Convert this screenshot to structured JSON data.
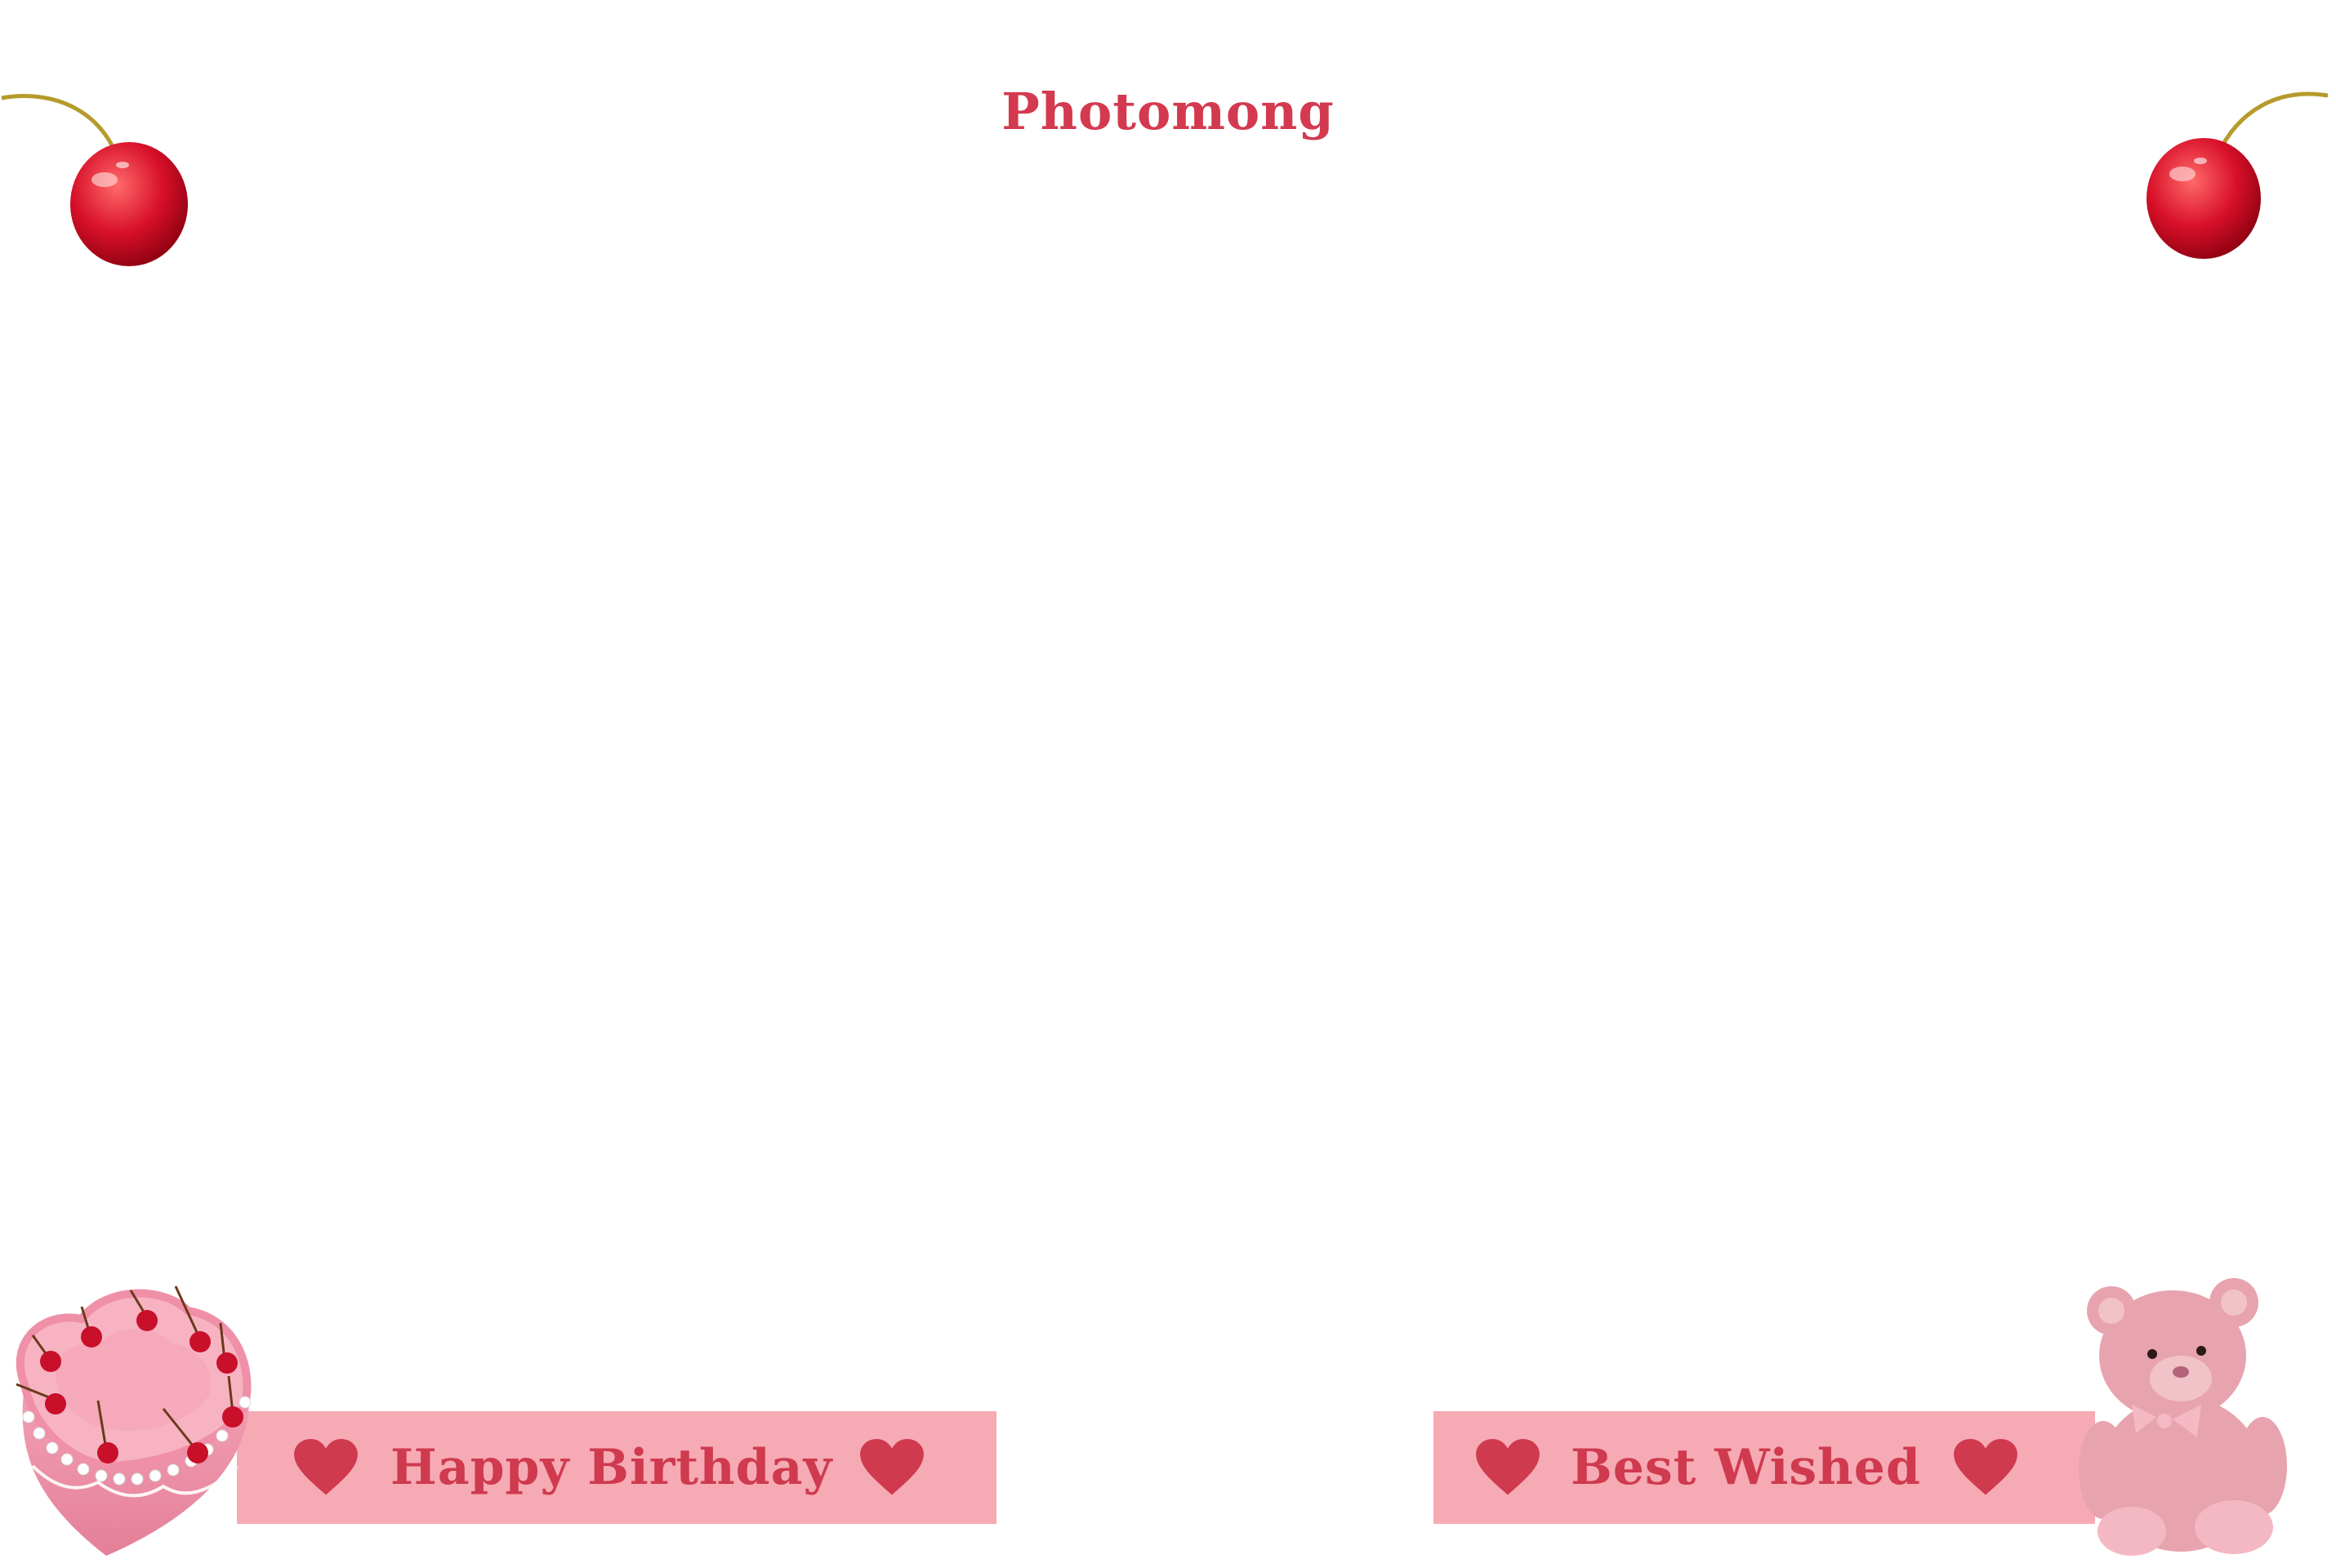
{
  "header": {
    "title": "Photomong"
  },
  "banners": {
    "left": {
      "text": "Happy Birthday"
    },
    "right": {
      "text": "Best Wished"
    }
  },
  "decorations": {
    "cherry_left": "cherry-icon",
    "cherry_right": "cherry-icon",
    "cake": "heart-cake-icon",
    "bear": "teddy-bear-icon",
    "heart": "heart-icon"
  },
  "colors": {
    "title": "#d33a4f",
    "banner": "#f5aab4",
    "banner_text": "#d03a4e",
    "cherry": "#d8102a"
  }
}
